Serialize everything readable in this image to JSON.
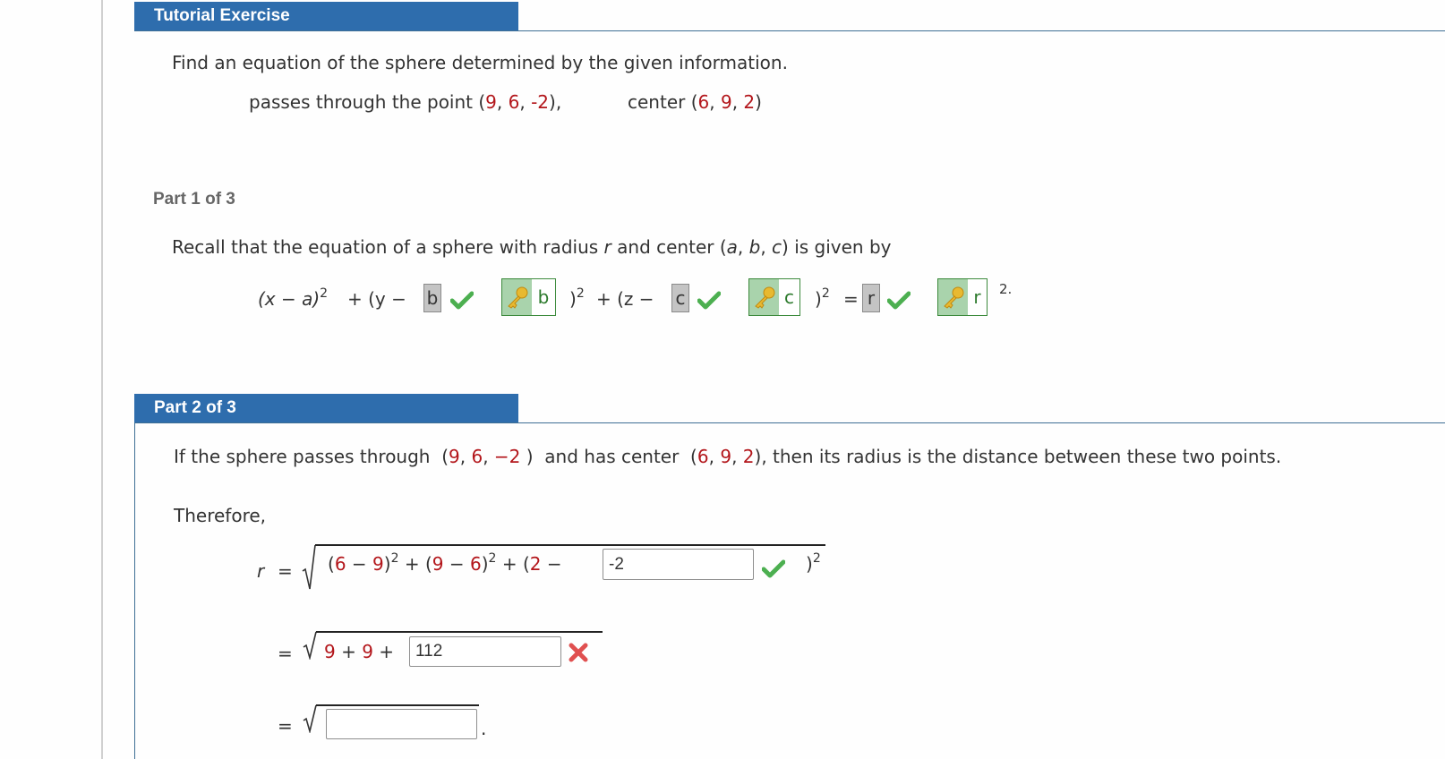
{
  "header": {
    "title": "Tutorial Exercise"
  },
  "problem": {
    "prompt": "Find an equation of the sphere determined by the given information.",
    "given_prefix": "passes through the point (",
    "point": [
      "9",
      "6",
      "-2"
    ],
    "given_mid": "),",
    "center_prefix": "center (",
    "center": [
      "6",
      "9",
      "2"
    ],
    "center_suffix": ")"
  },
  "part1": {
    "label": "Part 1 of 3",
    "recall_a": "Recall that the equation of a sphere with radius ",
    "recall_r": "r",
    "recall_b": " and center (",
    "recall_vars": [
      "a",
      "b",
      "c"
    ],
    "recall_c": ") is given by",
    "eq": {
      "term1": "(x − a)",
      "plus_y": "+ (y −",
      "answer_b": "b",
      "key_b": "b",
      "close_b": ")",
      "plus_z": "+ (z −",
      "answer_c": "c",
      "key_c": "c",
      "close_c": ")",
      "equals": "=",
      "answer_r": "r",
      "key_r": "r",
      "exp": "2",
      "end": "."
    },
    "status": {
      "b": "correct",
      "c": "correct",
      "r": "correct"
    }
  },
  "part2": {
    "label": "Part 2 of 3",
    "intro_a": "If the sphere passes through ",
    "intro_point": [
      "9",
      "6",
      "−2"
    ],
    "intro_b": " and has center ",
    "intro_center": [
      "6",
      "9",
      "2"
    ],
    "intro_c": ", then its radius is the distance between these two points.",
    "therefore": "Therefore,",
    "row1": {
      "lhs": "r",
      "eq": "=",
      "terms": [
        "6",
        "9",
        "9",
        "6",
        "2"
      ],
      "input_value": "-2",
      "status": "correct"
    },
    "row2": {
      "eq": "=",
      "a": "9",
      "b": "9",
      "input_value": "112",
      "status": "incorrect"
    },
    "row3": {
      "eq": "=",
      "input_value": "",
      "end": "."
    }
  },
  "colors": {
    "header_bg": "#2e6dad",
    "given_value": "#b3161b",
    "correct": "#4caf50",
    "incorrect": "#e05050",
    "key_bg": "#a9d3ac"
  }
}
